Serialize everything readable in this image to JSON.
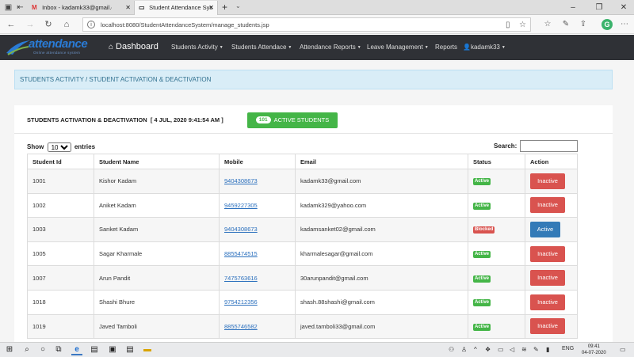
{
  "browser": {
    "tabs": [
      {
        "favicon": "M",
        "title": "Inbox - kadamk33@gmail.c"
      },
      {
        "favicon": "page-icon",
        "title": "Student Attendance Sys"
      }
    ],
    "url": "localhost:8080/StudentAttendanceSystem/manage_students.jsp",
    "extension_letter": "G"
  },
  "navbar": {
    "logo_text": "attendance",
    "logo_sub": "Online attendance system",
    "dashboard": "Dashboard",
    "menus": [
      "Students Activity",
      "Students Attendace",
      "Attendance Reports",
      "Leave Management",
      "Reports",
      "kadamk33"
    ]
  },
  "breadcrumb": "STUDENTS ACTIVITY / STUDENT ACTIVATION & DEACTIVATION",
  "card": {
    "title": "STUDENTS ACTIVATION & DEACTIVATION",
    "datetime": "[ 4 JUL, 2020 9:41:54 AM ]",
    "active_count": "101",
    "active_label": "ACTIVE STUDENTS"
  },
  "controls": {
    "show_label": "Show",
    "entries_value": "10",
    "entries_label": "entries",
    "search_label": "Search:"
  },
  "table": {
    "headers": [
      "Student Id",
      "Student Name",
      "Mobile",
      "Email",
      "Status",
      "Action"
    ],
    "rows": [
      {
        "id": "1001",
        "name": "Kishor Kadam",
        "mobile": "9404308673",
        "email": "kadamk33@gmail.com",
        "status": "Active",
        "action": "Inactive"
      },
      {
        "id": "1002",
        "name": "Aniket Kadam",
        "mobile": "9459227305",
        "email": "kadamk329@yahoo.com",
        "status": "Active",
        "action": "Inactive"
      },
      {
        "id": "1003",
        "name": "Sanket Kadam",
        "mobile": "9404308673",
        "email": "kadamsanket02@gmail.com",
        "status": "Blocked",
        "action": "Active"
      },
      {
        "id": "1005",
        "name": "Sagar Kharmale",
        "mobile": "8855474515",
        "email": "kharmalesagar@gmail.com",
        "status": "Active",
        "action": "Inactive"
      },
      {
        "id": "1007",
        "name": "Arun Pandit",
        "mobile": "7475763616",
        "email": "30arunpandit@gmail.com",
        "status": "Active",
        "action": "Inactive"
      },
      {
        "id": "1018",
        "name": "Shashi Bhure",
        "mobile": "9754212356",
        "email": "shash.88shashi@gmail.com",
        "status": "Active",
        "action": "Inactive"
      },
      {
        "id": "1019",
        "name": "Javed Tamboli",
        "mobile": "8855746582",
        "email": "javed.tamboli33@gmail.com",
        "status": "Active",
        "action": "Inactive"
      }
    ]
  },
  "taskbar": {
    "lang": "ENG",
    "time": "09:41",
    "date": "04-07-2020"
  },
  "colors": {
    "navbar": "#2f3136",
    "success": "#44b547",
    "danger": "#d9534f",
    "primary": "#337ab7",
    "breadcrumb_bg": "#d9edf7"
  }
}
